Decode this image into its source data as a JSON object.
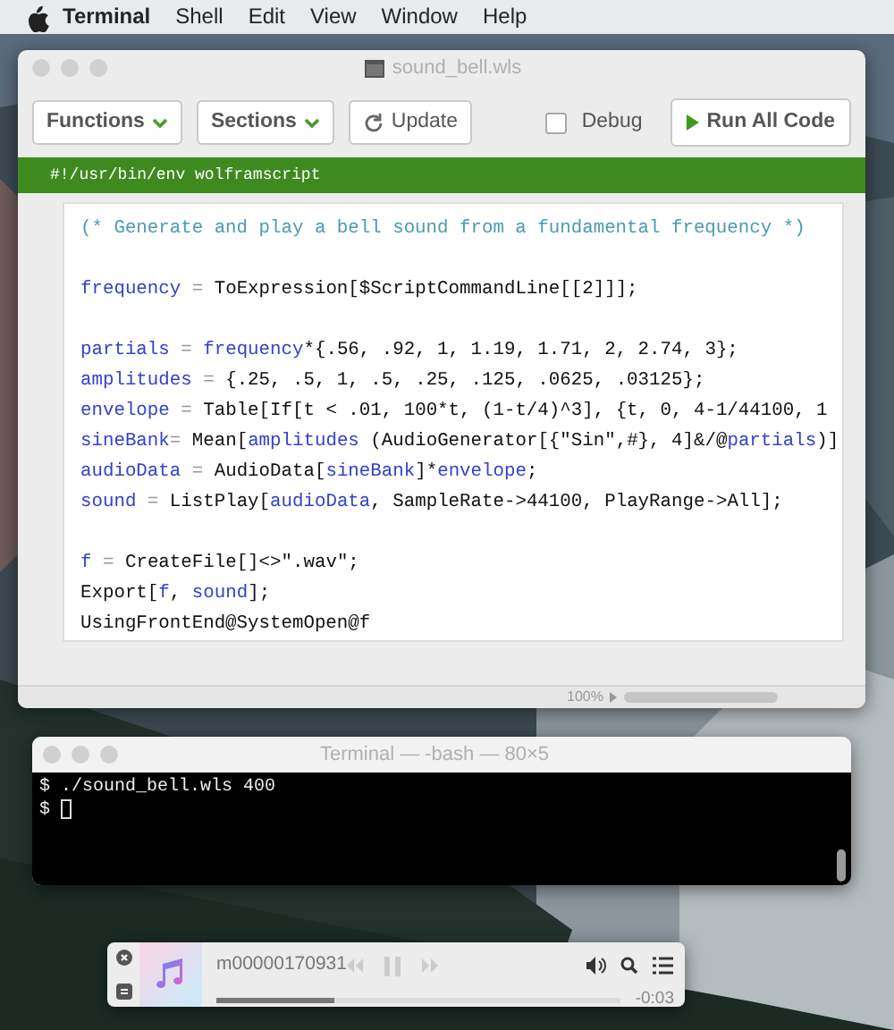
{
  "menu_bar": {
    "items": [
      {
        "label": "Terminal",
        "kind": "app"
      },
      {
        "label": "Shell",
        "kind": "menu"
      },
      {
        "label": "Edit",
        "kind": "menu"
      },
      {
        "label": "View",
        "kind": "menu"
      },
      {
        "label": "Window",
        "kind": "menu"
      },
      {
        "label": "Help",
        "kind": "menu"
      }
    ]
  },
  "editor_window": {
    "title": "sound_bell.wls",
    "toolbar": [
      {
        "label": "Functions",
        "kind": "dropdown"
      },
      {
        "label": "Sections",
        "kind": "dropdown"
      },
      {
        "label": "Update",
        "kind": "refresh"
      }
    ],
    "debug": {
      "label": "Debug",
      "checked": false
    },
    "run_button": {
      "label": "Run All Code"
    },
    "shebang": "#!/usr/bin/env wolframscript",
    "code_lines": [
      {
        "kind": "code",
        "tokens": [
          {
            "t": "(* Generate and play a bell sound from a fundamental frequency *)",
            "kind": "comment"
          }
        ]
      },
      {
        "kind": "blank"
      },
      {
        "kind": "code",
        "tokens": [
          {
            "t": "frequency",
            "kind": "var"
          },
          {
            "t": " = ",
            "kind": "punct"
          },
          {
            "t": "ToExpression[$ScriptCommandLine[[2]]];",
            "kind": "plain"
          }
        ]
      },
      {
        "kind": "blank"
      },
      {
        "kind": "code",
        "tokens": [
          {
            "t": "partials",
            "kind": "var"
          },
          {
            "t": " = ",
            "kind": "punct"
          },
          {
            "t": "frequency",
            "kind": "var"
          },
          {
            "t": "*{.56, .92, 1, 1.19, 1.71, 2, 2.74, 3};",
            "kind": "plain"
          }
        ]
      },
      {
        "kind": "code",
        "tokens": [
          {
            "t": "amplitudes",
            "kind": "var"
          },
          {
            "t": " = ",
            "kind": "punct"
          },
          {
            "t": "{.25, .5, 1, .5, .25, .125, .0625, .03125};",
            "kind": "plain"
          }
        ]
      },
      {
        "kind": "code",
        "tokens": [
          {
            "t": "envelope",
            "kind": "var"
          },
          {
            "t": " = ",
            "kind": "punct"
          },
          {
            "t": "Table[If[t < .01, 100*t, (1-t/4)^3], {t, 0, 4-1/44100, 1",
            "kind": "plain"
          }
        ]
      },
      {
        "kind": "code",
        "tokens": [
          {
            "t": "sineBank",
            "kind": "var"
          },
          {
            "t": "= ",
            "kind": "punct"
          },
          {
            "t": "Mean[",
            "kind": "plain"
          },
          {
            "t": "amplitudes",
            "kind": "var"
          },
          {
            "t": " (AudioGenerator[{\"Sin\",#}, 4]&/@",
            "kind": "plain"
          },
          {
            "t": "partials",
            "kind": "var"
          },
          {
            "t": ")]",
            "kind": "plain"
          }
        ]
      },
      {
        "kind": "code",
        "tokens": [
          {
            "t": "audioData",
            "kind": "var"
          },
          {
            "t": " = ",
            "kind": "punct"
          },
          {
            "t": "AudioData[",
            "kind": "plain"
          },
          {
            "t": "sineBank",
            "kind": "var"
          },
          {
            "t": "]*",
            "kind": "plain"
          },
          {
            "t": "envelope",
            "kind": "var"
          },
          {
            "t": ";",
            "kind": "plain"
          }
        ]
      },
      {
        "kind": "code",
        "tokens": [
          {
            "t": "sound",
            "kind": "var"
          },
          {
            "t": " = ",
            "kind": "punct"
          },
          {
            "t": "ListPlay[",
            "kind": "plain"
          },
          {
            "t": "audioData",
            "kind": "var"
          },
          {
            "t": ", SampleRate->44100, PlayRange->All];",
            "kind": "plain"
          }
        ]
      },
      {
        "kind": "blank"
      },
      {
        "kind": "code",
        "tokens": [
          {
            "t": "f",
            "kind": "var"
          },
          {
            "t": " = ",
            "kind": "punct"
          },
          {
            "t": "CreateFile[]<>\".wav\";",
            "kind": "plain"
          }
        ]
      },
      {
        "kind": "code",
        "tokens": [
          {
            "t": "Export[",
            "kind": "plain"
          },
          {
            "t": "f",
            "kind": "var"
          },
          {
            "t": ", ",
            "kind": "plain"
          },
          {
            "t": "sound",
            "kind": "var"
          },
          {
            "t": "];",
            "kind": "plain"
          }
        ]
      },
      {
        "kind": "code",
        "tokens": [
          {
            "t": "UsingFrontEnd@SystemOpen@f",
            "kind": "plain"
          }
        ]
      }
    ],
    "zoom": "100%"
  },
  "terminal_window": {
    "title": "Terminal — -bash — 80×5",
    "lines": [
      {
        "text": "$ ./sound_bell.wls 400",
        "cursor": false
      },
      {
        "text": "$ ",
        "cursor": true
      }
    ]
  },
  "mini_player": {
    "track": "m00000170931",
    "remaining": "-0:03",
    "level": 0.29
  }
}
